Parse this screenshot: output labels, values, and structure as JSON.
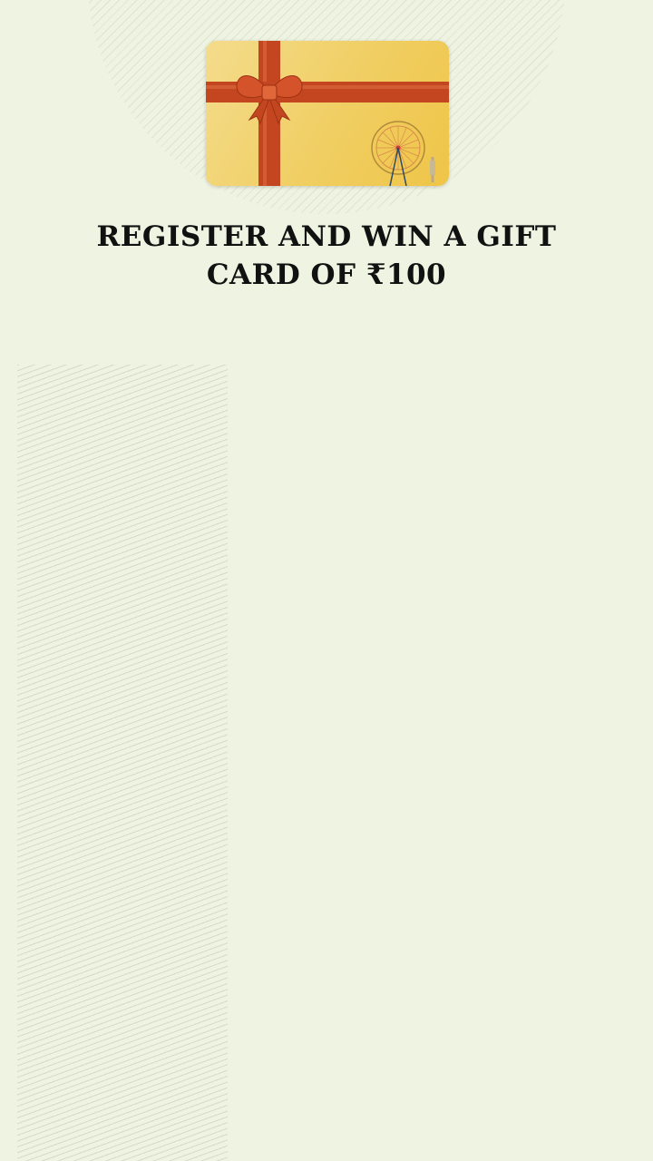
{
  "promo": {
    "headline_line1": "REGISTER AND WIN A GIFT",
    "headline_line2": "CARD OF ₹100"
  },
  "gift_card": {
    "ribbon_color": "#c94a22",
    "card_color": "#f0ce62",
    "icons": [
      "ribbon-bow-icon",
      "ferris-wheel-icon"
    ]
  },
  "colors": {
    "background": "#eff3e2",
    "text": "#111111"
  }
}
